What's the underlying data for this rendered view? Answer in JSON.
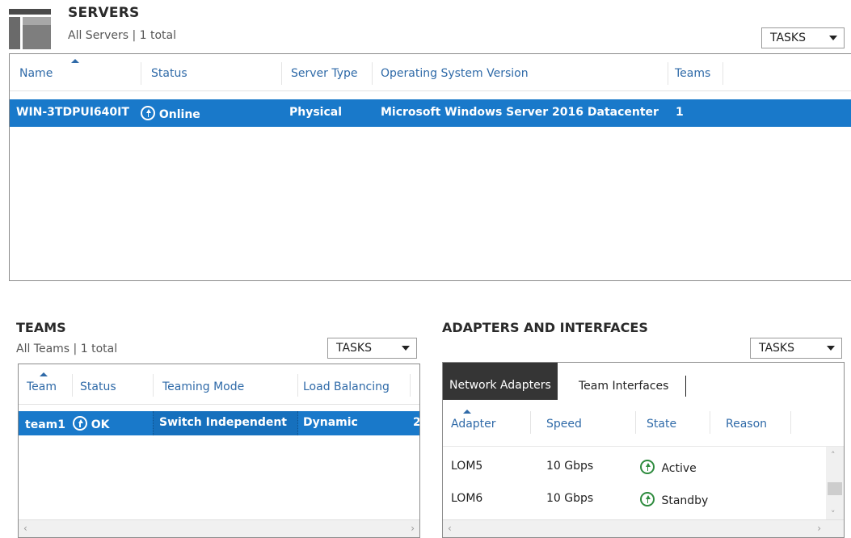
{
  "servers": {
    "title": "SERVERS",
    "subtitle": "All Servers | 1 total",
    "tasks_label": "TASKS",
    "columns": [
      "Name",
      "Status",
      "Server Type",
      "Operating System Version",
      "Teams"
    ],
    "rows": [
      {
        "name": "WIN-3TDPUI640IT",
        "status": "Online",
        "server_type": "Physical",
        "os": "Microsoft Windows Server 2016 Datacenter",
        "teams": "1"
      }
    ]
  },
  "teams": {
    "title": "TEAMS",
    "subtitle": "All Teams | 1 total",
    "tasks_label": "TASKS",
    "columns": [
      "Team",
      "Status",
      "Teaming Mode",
      "Load Balancing"
    ],
    "rows": [
      {
        "team": "team1",
        "status": "OK",
        "mode": "Switch Independent",
        "load_balancing": "Dynamic",
        "truncated": "2"
      }
    ]
  },
  "adapters": {
    "title": "ADAPTERS AND INTERFACES",
    "tasks_label": "TASKS",
    "tabs": [
      "Network Adapters",
      "Team Interfaces"
    ],
    "columns": [
      "Adapter",
      "Speed",
      "State",
      "Reason"
    ],
    "rows": [
      {
        "adapter": "LOM5",
        "speed": "10 Gbps",
        "state": "Active"
      },
      {
        "adapter": "LOM6",
        "speed": "10 Gbps",
        "state": "Standby"
      }
    ]
  },
  "colors": {
    "selection_blue": "#1979ca",
    "header_link_blue": "#2f6aa8",
    "status_green": "#2e8b3e",
    "active_tab_dark": "#353535"
  },
  "icons": {
    "servers_section": "servers-icon",
    "status_online": "up-arrow-circle-icon",
    "dropdown": "chevron-down-icon"
  }
}
